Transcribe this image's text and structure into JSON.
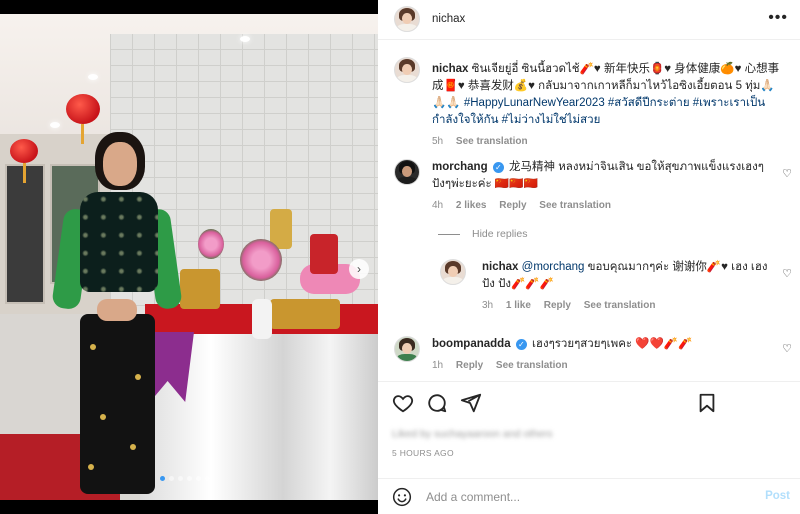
{
  "post": {
    "author": "nichax",
    "caption_username": "nichax",
    "caption_text": "ซินเจียยู่อี่ ซินนี้ฮวดไช้🧨♥ 新年快乐🏮♥ 身体健康🍊♥ 心想事成🧧♥ 恭喜发财💰♥ กลับมาจากเกาหลีก็มาไหว้ไอซิงเอี้ยตอน 5 ทุ่ม🙏🏻🙏🏻🙏🏻",
    "caption_tags": "#HappyLunarNewYear2023 #สวัสดีปีกระต่าย #เพราะเราเป็นกำลังใจให้กัน #ไม่ว่างไม่ใช่ไม่สวย",
    "caption_time": "5h",
    "see_translation": "See translation",
    "carousel_dots": 6
  },
  "comments": [
    {
      "username": "morchang",
      "verified": true,
      "text": "龙马精神 หลงหม่าจินเสิน ขอให้สุขภาพแข็งแรงเฮงๆ ปังๆพ่ะยะค่ะ 🇨🇳🇨🇳🇨🇳",
      "time": "4h",
      "likes": "2 likes",
      "reply": "Reply",
      "see_translation": "See translation"
    },
    {
      "username": "boompanadda",
      "verified": true,
      "text": "เฮงๆรวยๆสวยๆเพคะ ❤️❤️🧨🧨",
      "time": "1h",
      "reply": "Reply",
      "see_translation": "See translation"
    }
  ],
  "hide_replies": "Hide replies",
  "reply": {
    "username": "nichax",
    "mention": "@morchang",
    "text": " ขอบคุณมากๆค่ะ 谢谢你🧨♥ เฮง เฮง ปัง ปัง🧨🧨🧨",
    "time": "3h",
    "likes": "1 like",
    "reply": "Reply",
    "see_translation": "See translation"
  },
  "liked_by": "Liked by suchayaaroon and others",
  "timestamp": "5 HOURS AGO",
  "composer": {
    "placeholder": "Add a comment...",
    "post_label": "Post"
  },
  "icons": {
    "more": "more-options-icon",
    "heart": "heart-icon",
    "comment": "comment-icon",
    "share": "share-icon",
    "save": "bookmark-icon",
    "emoji": "emoji-icon",
    "next": "chevron-right-icon"
  },
  "colors": {
    "link": "#00376b",
    "muted": "#8e8e8e",
    "post_button": "#b2dffc",
    "verified": "#3897f0"
  }
}
